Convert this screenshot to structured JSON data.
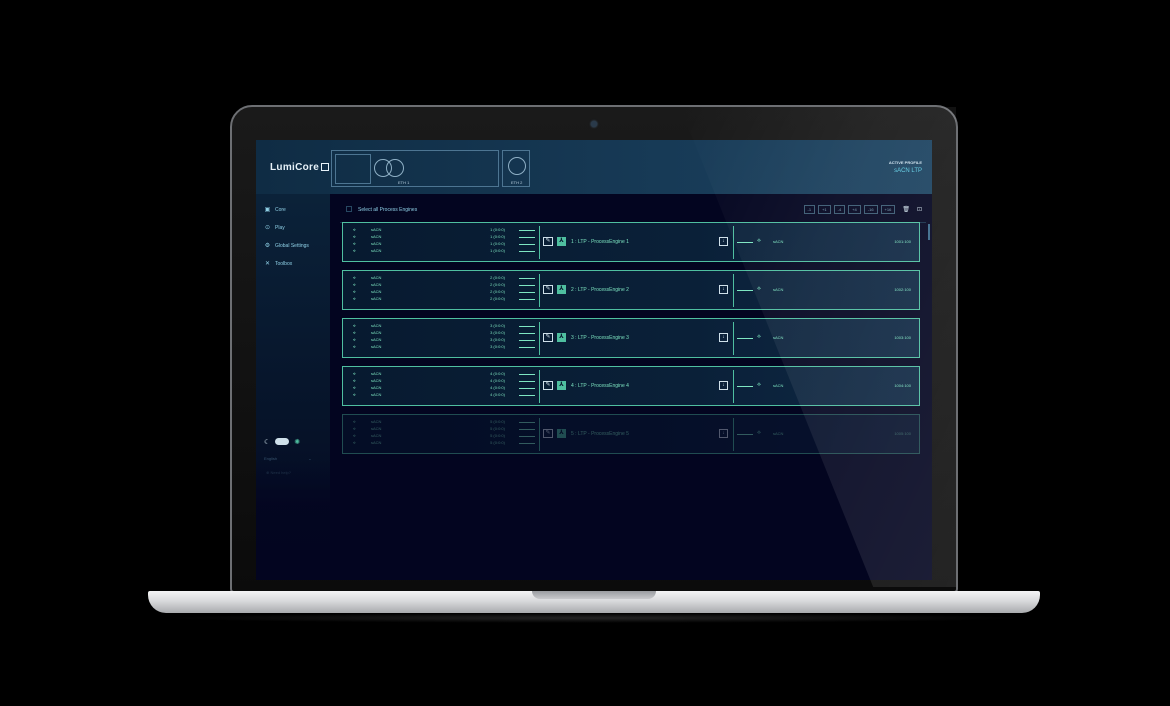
{
  "app": {
    "logo": "LumiCore",
    "eth1_label": "ETH 1",
    "eth2_label": "ETH 2",
    "profile_caption": "ACTIVE PROFILE",
    "profile_value": "sACN LTP"
  },
  "sidebar": {
    "items": [
      {
        "label": "Core",
        "icon": "core-icon"
      },
      {
        "label": "Play",
        "icon": "play-icon"
      },
      {
        "label": "Global Settings",
        "icon": "gear-icon"
      },
      {
        "label": "Toolbox",
        "icon": "toolbox-icon"
      }
    ],
    "language": "English",
    "help": "Need help?"
  },
  "toolbar": {
    "select_all": "Select all Process Engines",
    "steps": [
      "-1",
      "+1",
      "-4",
      "+4",
      "-16",
      "+16"
    ]
  },
  "engines": [
    {
      "name": "1 : LTP - ProcessEngine 1",
      "inputs": [
        {
          "proto": "sACN",
          "universe": "1 (0:0:0)"
        },
        {
          "proto": "sACN",
          "universe": "1 (0:0:0)"
        },
        {
          "proto": "sACN",
          "universe": "1 (0:0:0)"
        },
        {
          "proto": "sACN",
          "universe": "1 (0:0:0)"
        }
      ],
      "output": {
        "proto": "sACN",
        "universe": "1001:100"
      }
    },
    {
      "name": "2 : LTP - ProcessEngine 2",
      "inputs": [
        {
          "proto": "sACN",
          "universe": "2 (0:0:0)"
        },
        {
          "proto": "sACN",
          "universe": "2 (0:0:0)"
        },
        {
          "proto": "sACN",
          "universe": "2 (0:0:0)"
        },
        {
          "proto": "sACN",
          "universe": "2 (0:0:0)"
        }
      ],
      "output": {
        "proto": "sACN",
        "universe": "1002:100"
      }
    },
    {
      "name": "3 : LTP - ProcessEngine 3",
      "inputs": [
        {
          "proto": "sACN",
          "universe": "3 (0:0:0)"
        },
        {
          "proto": "sACN",
          "universe": "3 (0:0:0)"
        },
        {
          "proto": "sACN",
          "universe": "3 (0:0:0)"
        },
        {
          "proto": "sACN",
          "universe": "3 (0:0:0)"
        }
      ],
      "output": {
        "proto": "sACN",
        "universe": "1003:100"
      }
    },
    {
      "name": "4 : LTP - ProcessEngine 4",
      "inputs": [
        {
          "proto": "sACN",
          "universe": "4 (0:0:0)"
        },
        {
          "proto": "sACN",
          "universe": "4 (0:0:0)"
        },
        {
          "proto": "sACN",
          "universe": "4 (0:0:0)"
        },
        {
          "proto": "sACN",
          "universe": "4 (0:0:0)"
        }
      ],
      "output": {
        "proto": "sACN",
        "universe": "1004:100"
      }
    },
    {
      "name": "5 : LTP - ProcessEngine 5",
      "inputs": [
        {
          "proto": "sACN",
          "universe": "5 (0:0:0)"
        },
        {
          "proto": "sACN",
          "universe": "5 (0:0:0)"
        },
        {
          "proto": "sACN",
          "universe": "5 (0:0:0)"
        },
        {
          "proto": "sACN",
          "universe": "5 (0:0:0)"
        }
      ],
      "output": {
        "proto": "sACN",
        "universe": "1005:100"
      }
    }
  ],
  "colors": {
    "accent": "#4fbfa0",
    "text_accent": "#7ee6c2",
    "header": "#173a56",
    "background": "#030520"
  }
}
